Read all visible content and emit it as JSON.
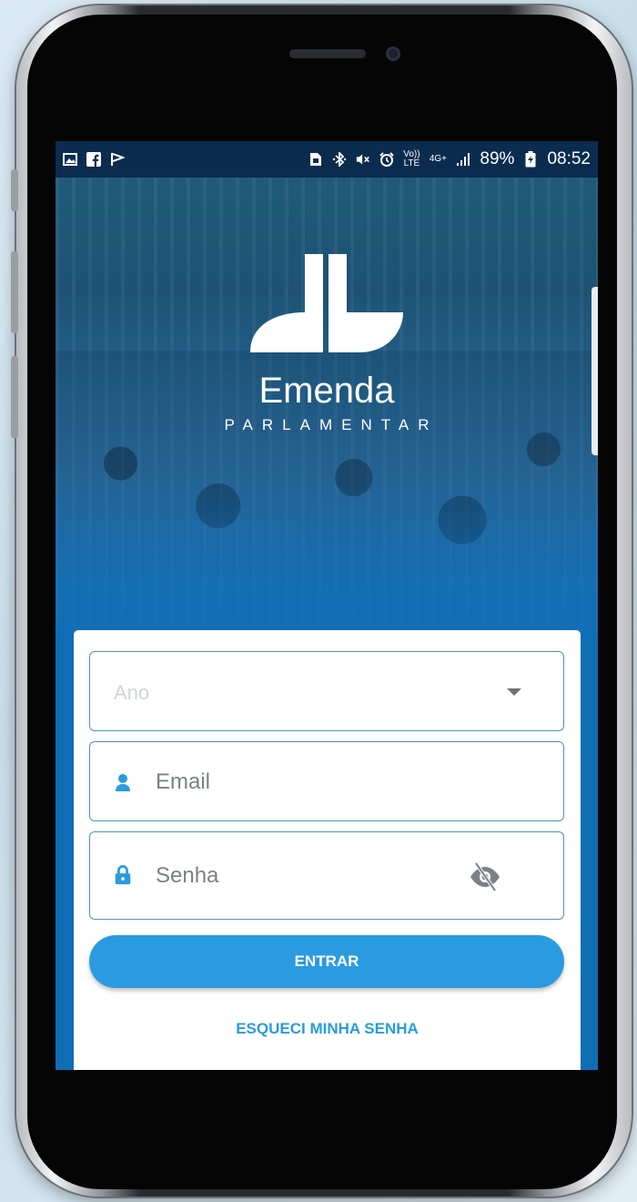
{
  "status_bar": {
    "left_icons": [
      "image-icon",
      "facebook-icon",
      "flag-icon"
    ],
    "right_icons": [
      "sim-icon",
      "bluetooth-icon",
      "mute-icon",
      "alarm-icon",
      "volte-icon",
      "4g-icon",
      "signal-icon",
      "battery-icon"
    ],
    "volte_label_top": "Vo))",
    "volte_label_bottom": "LTE",
    "network_label": "4G+",
    "battery": "89%",
    "time": "08:52"
  },
  "app": {
    "name": "Emenda",
    "subtitle": "PARLAMENTAR"
  },
  "form": {
    "ano_placeholder": "Ano",
    "email_placeholder": "Email",
    "senha_placeholder": "Senha",
    "submit_label": "ENTRAR",
    "forgot_label": "ESQUECI MINHA SENHA"
  },
  "colors": {
    "primary": "#2a9be0",
    "field_border": "#4a92c6",
    "status_bar": "#0b2c4f"
  }
}
